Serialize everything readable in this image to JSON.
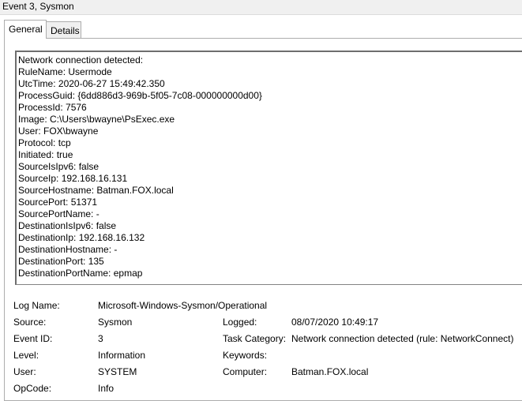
{
  "window": {
    "title": "Event 3, Sysmon"
  },
  "tabs": [
    {
      "label": "General",
      "active": true
    },
    {
      "label": "Details",
      "active": false
    }
  ],
  "description": {
    "lines": [
      "Network connection detected:",
      "RuleName: Usermode",
      "UtcTime: 2020-06-27 15:49:42.350",
      "ProcessGuid: {6dd886d3-969b-5f05-7c08-000000000d00}",
      "ProcessId: 7576",
      "Image: C:\\Users\\bwayne\\PsExec.exe",
      "User: FOX\\bwayne",
      "Protocol: tcp",
      "Initiated: true",
      "SourceIsIpv6: false",
      "SourceIp: 192.168.16.131",
      "SourceHostname: Batman.FOX.local",
      "SourcePort: 51371",
      "SourcePortName: -",
      "DestinationIsIpv6: false",
      "DestinationIp: 192.168.16.132",
      "DestinationHostname: -",
      "DestinationPort: 135",
      "DestinationPortName: epmap"
    ]
  },
  "properties": {
    "log_name_label": "Log Name:",
    "log_name_value": "Microsoft-Windows-Sysmon/Operational",
    "source_label": "Source:",
    "source_value": "Sysmon",
    "logged_label": "Logged:",
    "logged_value": "08/07/2020 10:49:17",
    "event_id_label": "Event ID:",
    "event_id_value": "3",
    "task_category_label": "Task Category:",
    "task_category_value": "Network connection detected (rule: NetworkConnect)",
    "level_label": "Level:",
    "level_value": "Information",
    "keywords_label": "Keywords:",
    "keywords_value": "",
    "user_label": "User:",
    "user_value": "SYSTEM",
    "computer_label": "Computer:",
    "computer_value": "Batman.FOX.local",
    "opcode_label": "OpCode:",
    "opcode_value": "Info"
  }
}
